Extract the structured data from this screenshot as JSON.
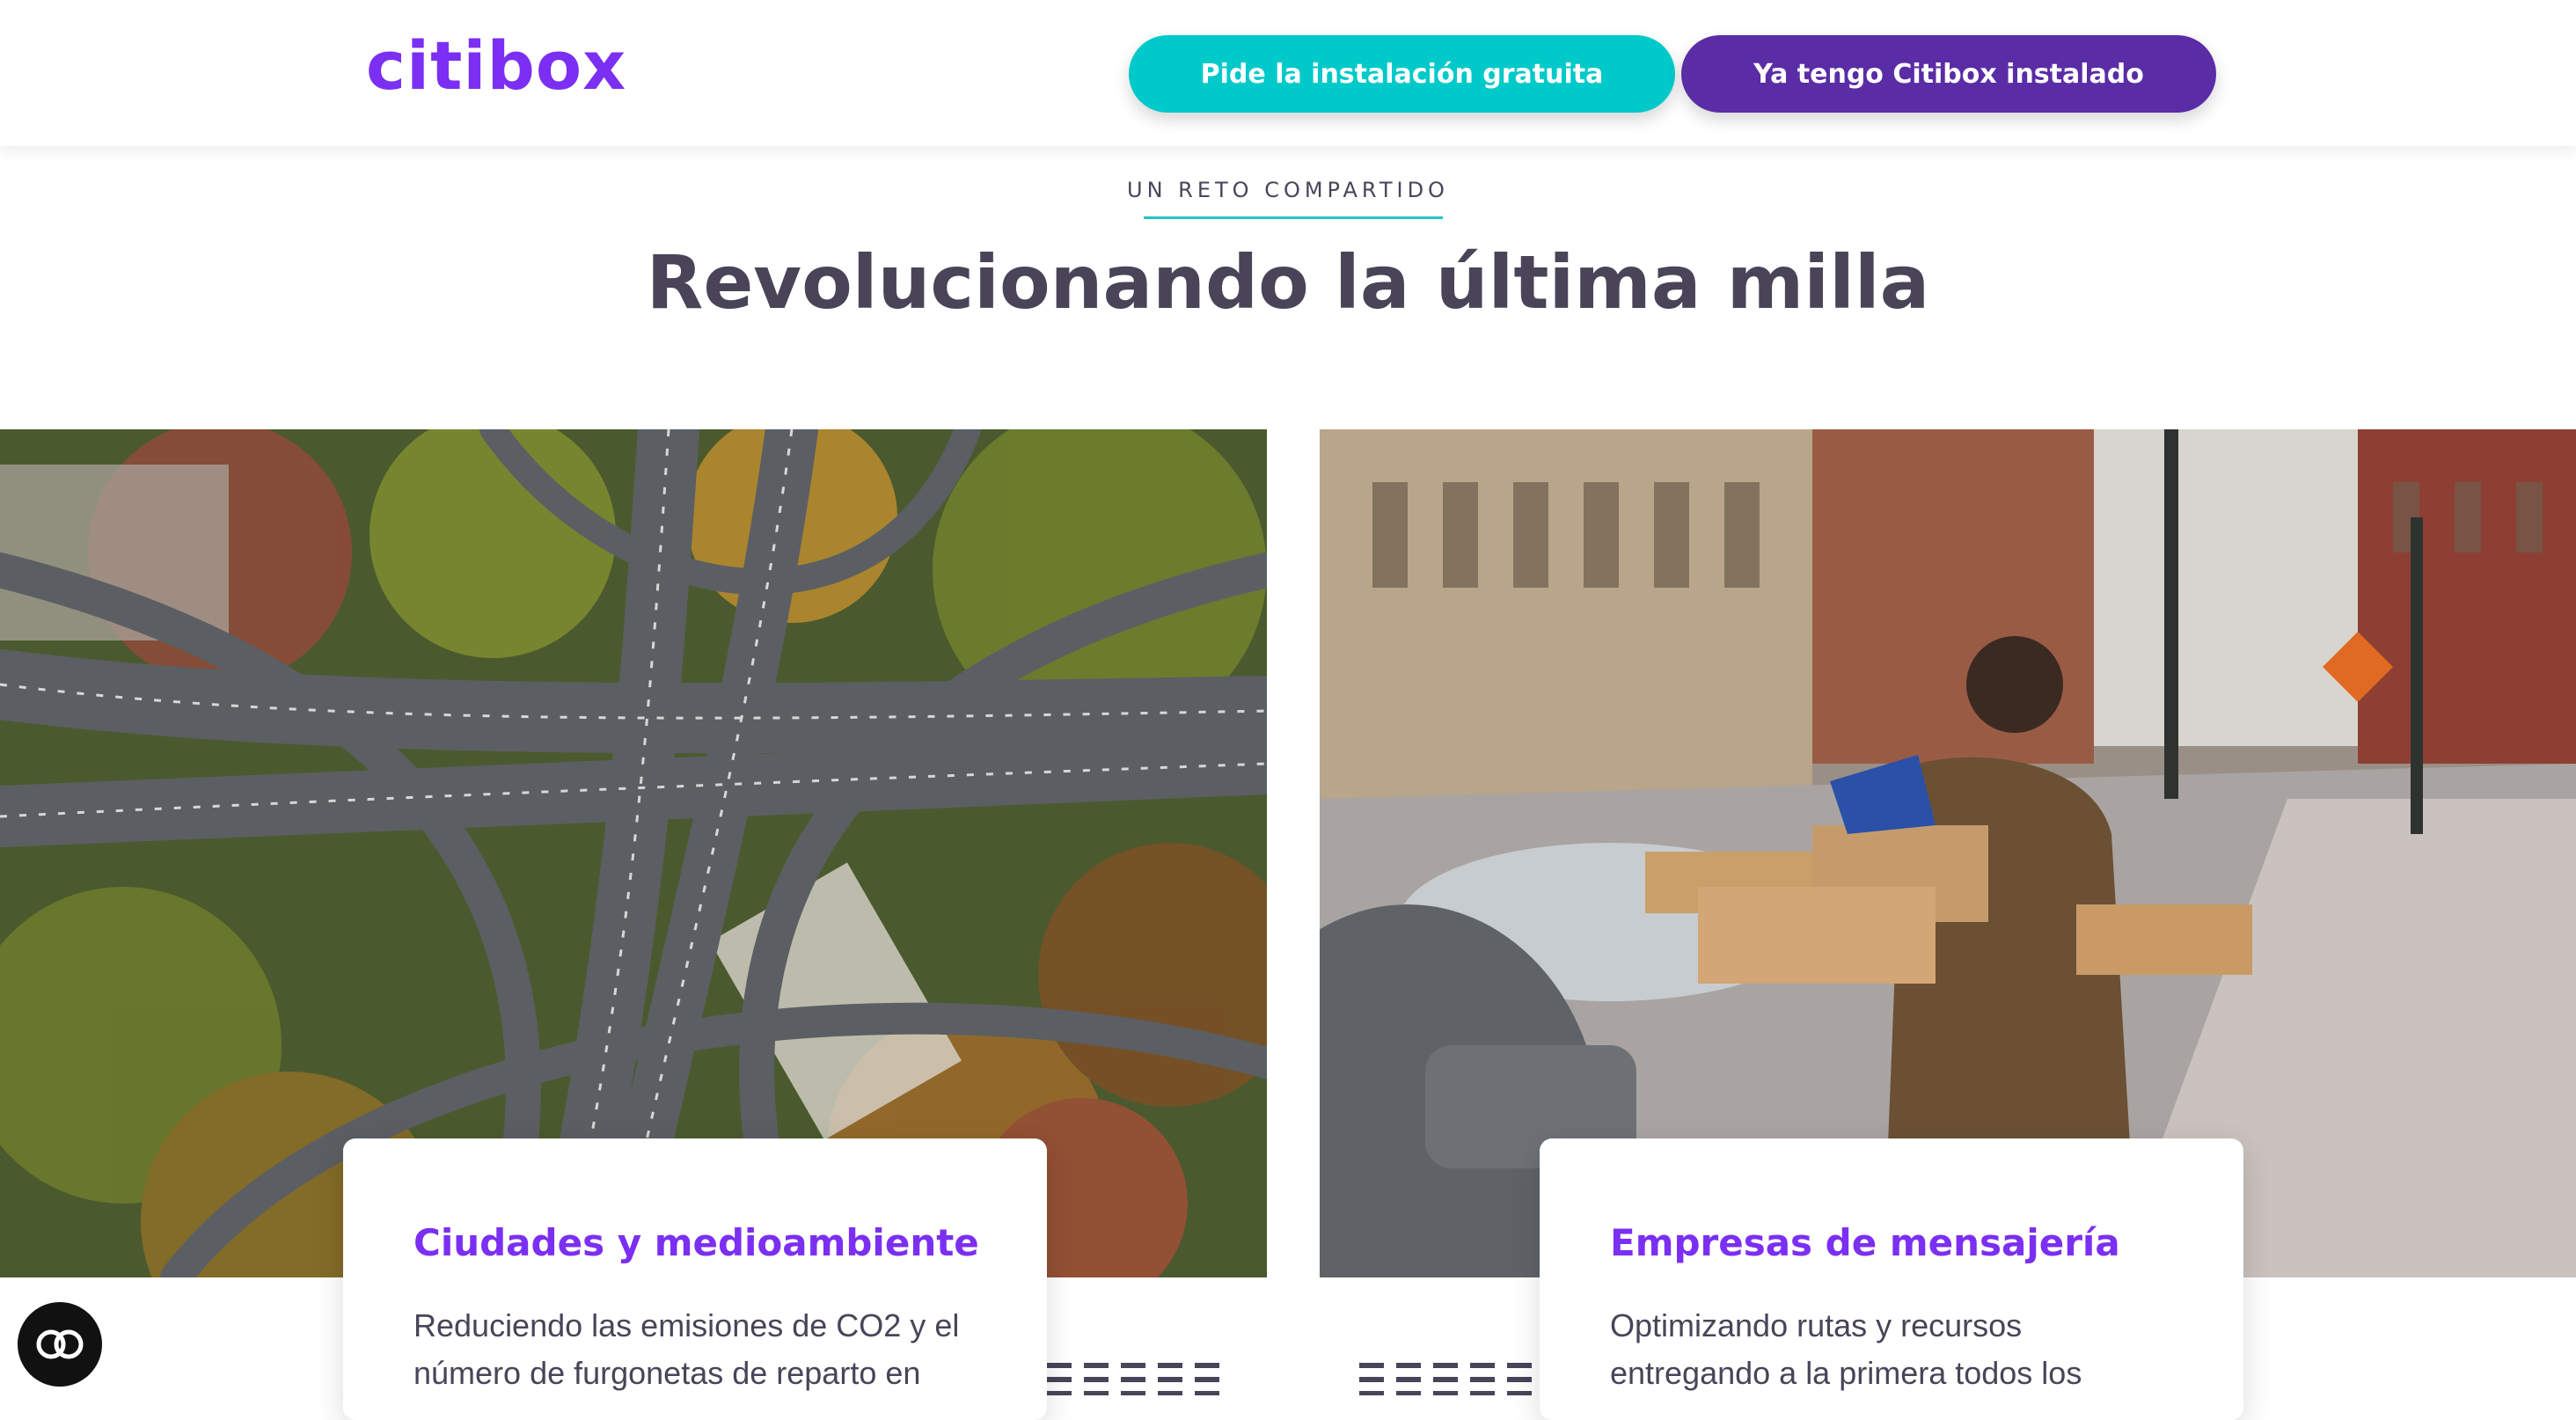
{
  "header": {
    "logo_text": "citibox",
    "install_button_label": "Pide la instalación gratuita",
    "installed_button_label": "Ya tengo Citibox instalado"
  },
  "section": {
    "eyebrow": "UN RETO COMPARTIDO",
    "title": "Revolucionando la última milla"
  },
  "cards": [
    {
      "title": "Ciudades y medioambiente",
      "text": "Reduciendo las emisiones de CO2 y el número de furgonetas de reparto en"
    },
    {
      "title": "Empresas de mensajería",
      "text": "Optimizando rutas y recursos entregando a la primera todos los"
    }
  ],
  "chat": {
    "icon": "chat-bubble-icon"
  },
  "colors": {
    "brand_purple": "#7b2ff2",
    "teal_button": "#00c9c9",
    "dark_purple_button": "#5a2ca6",
    "heading_text": "#4a4458"
  }
}
